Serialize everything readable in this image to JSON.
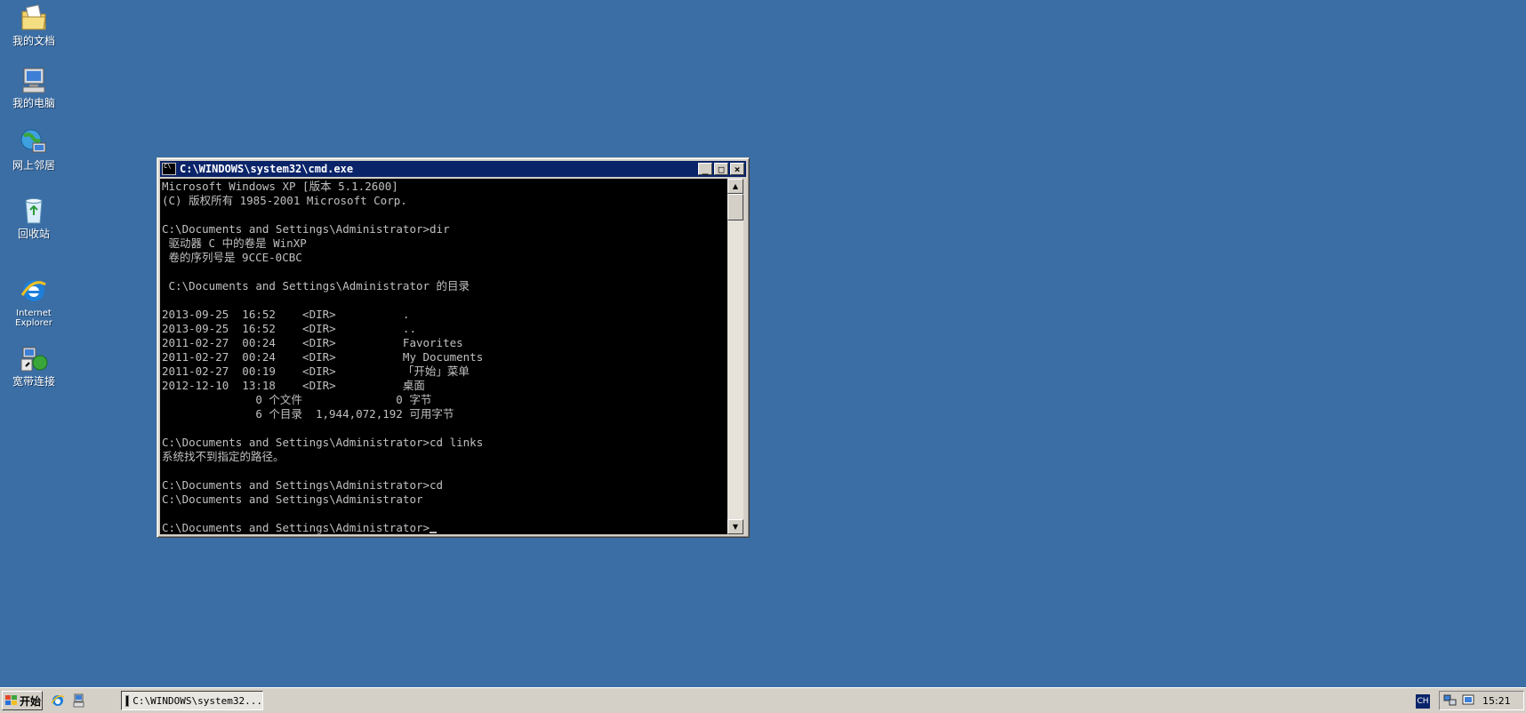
{
  "desktop": {
    "icons": [
      {
        "label": "我的文档",
        "icon": "my-documents-icon"
      },
      {
        "label": "我的电脑",
        "icon": "my-computer-icon"
      },
      {
        "label": "网上邻居",
        "icon": "network-places-icon"
      },
      {
        "label": "回收站",
        "icon": "recycle-bin-icon"
      },
      {
        "label_line1": "Internet",
        "label_line2": "Explorer",
        "icon": "internet-explorer-icon"
      },
      {
        "label": "宽带连接",
        "icon": "broadband-connection-icon"
      }
    ]
  },
  "window": {
    "title": "C:\\WINDOWS\\system32\\cmd.exe",
    "minimize": "_",
    "maximize": "□",
    "close": "×",
    "console_lines": [
      "Microsoft Windows XP [版本 5.1.2600]",
      "(C) 版权所有 1985-2001 Microsoft Corp.",
      "",
      "C:\\Documents and Settings\\Administrator>dir",
      " 驱动器 C 中的卷是 WinXP",
      " 卷的序列号是 9CCE-0CBC",
      "",
      " C:\\Documents and Settings\\Administrator 的目录",
      "",
      "2013-09-25  16:52    <DIR>          .",
      "2013-09-25  16:52    <DIR>          ..",
      "2011-02-27  00:24    <DIR>          Favorites",
      "2011-02-27  00:24    <DIR>          My Documents",
      "2011-02-27  00:19    <DIR>          「开始」菜单",
      "2012-12-10  13:18    <DIR>          桌面",
      "              0 个文件              0 字节",
      "              6 个目录  1,944,072,192 可用字节",
      "",
      "C:\\Documents and Settings\\Administrator>cd links",
      "系统找不到指定的路径。",
      "",
      "C:\\Documents and Settings\\Administrator>cd",
      "C:\\Documents and Settings\\Administrator",
      "",
      "C:\\Documents and Settings\\Administrator>"
    ]
  },
  "taskbar": {
    "start_label": "开始",
    "task_label": "C:\\WINDOWS\\system32...",
    "ime_label": "CH",
    "clock": "15:21"
  },
  "colors": {
    "desktop": "#3a6ea5",
    "titlebar": "#0a246a",
    "console_bg": "#000000",
    "console_fg": "#c0c0c0",
    "chrome": "#d4d0c8"
  }
}
